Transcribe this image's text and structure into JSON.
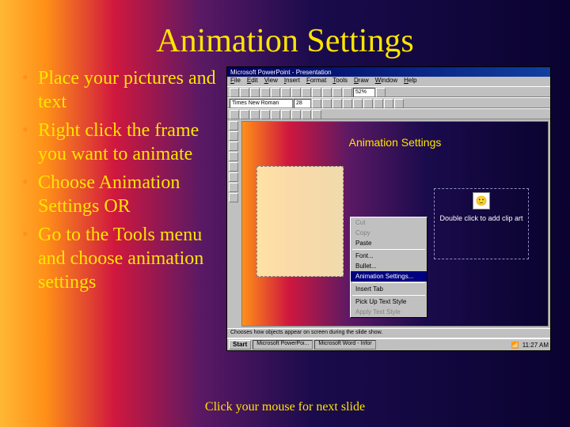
{
  "title": "Animation Settings",
  "bullets": [
    "Place your pictures and text",
    "Right click the frame you want to animate",
    "Choose Animation Settings OR",
    "Go to the Tools menu and choose animation settings"
  ],
  "footer": "Click your mouse for next slide",
  "app": {
    "titlebar": "Microsoft PowerPoint - Presentation",
    "menus": [
      "File",
      "Edit",
      "View",
      "Insert",
      "Format",
      "Tools",
      "Draw",
      "Window",
      "Help"
    ],
    "font_name": "Times New Roman",
    "font_size": "28",
    "zoom": "52%",
    "inner_title": "Animation Settings",
    "clip_label": "Double click to add clip art",
    "statusbar": "Chooses how objects appear on screen during the slide show.",
    "context_menu": [
      {
        "label": "Cut",
        "disabled": true
      },
      {
        "label": "Copy",
        "disabled": true
      },
      {
        "label": "Paste",
        "disabled": false
      },
      {
        "sep": true
      },
      {
        "label": "Font...",
        "disabled": false
      },
      {
        "label": "Bullet...",
        "disabled": false
      },
      {
        "label": "Animation Settings...",
        "selected": true
      },
      {
        "sep": true
      },
      {
        "label": "Insert Tab",
        "disabled": false
      },
      {
        "sep": true
      },
      {
        "label": "Pick Up Text Style",
        "disabled": false
      },
      {
        "label": "Apply Text Style",
        "disabled": true
      }
    ],
    "taskbar": {
      "start": "Start",
      "buttons": [
        "Microsoft PowerPoi...",
        "Microsoft Word - Infor"
      ],
      "clock": "11:27 AM"
    }
  }
}
